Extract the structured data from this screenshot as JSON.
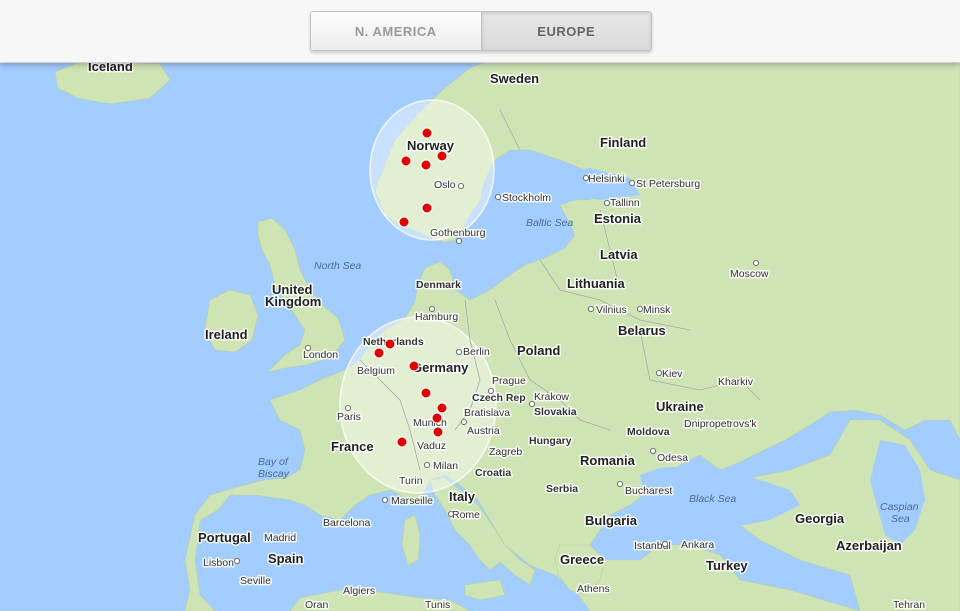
{
  "tabs": [
    {
      "label": "N. AMERICA",
      "active": false
    },
    {
      "label": "EUROPE",
      "active": true
    }
  ],
  "map": {
    "colors": {
      "water": "#a3ccff",
      "land": "#cfe4b4",
      "station": "#e00000",
      "coverage": "#ffffff"
    },
    "countries": [
      {
        "name": "Iceland"
      },
      {
        "name": "Sweden"
      },
      {
        "name": "Norway"
      },
      {
        "name": "Finland"
      },
      {
        "name": "Estonia"
      },
      {
        "name": "Latvia"
      },
      {
        "name": "Lithuania"
      },
      {
        "name": "Belarus"
      },
      {
        "name": "Denmark"
      },
      {
        "name": "United"
      },
      {
        "name": "Kingdom"
      },
      {
        "name": "Ireland"
      },
      {
        "name": "Netherlands"
      },
      {
        "name": "Belgium"
      },
      {
        "name": "Germany"
      },
      {
        "name": "Poland"
      },
      {
        "name": "Czech Rep"
      },
      {
        "name": "Slovakia"
      },
      {
        "name": "Ukraine"
      },
      {
        "name": "France"
      },
      {
        "name": "Austria"
      },
      {
        "name": "Hungary"
      },
      {
        "name": "Moldova"
      },
      {
        "name": "Romania"
      },
      {
        "name": "Croatia"
      },
      {
        "name": "Serbia"
      },
      {
        "name": "Italy"
      },
      {
        "name": "Bulgaria"
      },
      {
        "name": "Georgia"
      },
      {
        "name": "Azerbaijan"
      },
      {
        "name": "Portugal"
      },
      {
        "name": "Spain"
      },
      {
        "name": "Greece"
      },
      {
        "name": "Turkey"
      }
    ],
    "cities": [
      {
        "name": "Oslo"
      },
      {
        "name": "Stockholm"
      },
      {
        "name": "Helsinki"
      },
      {
        "name": "St Petersburg"
      },
      {
        "name": "Tallinn"
      },
      {
        "name": "Gothenburg"
      },
      {
        "name": "Moscow"
      },
      {
        "name": "Vilnius"
      },
      {
        "name": "Minsk"
      },
      {
        "name": "Hamburg"
      },
      {
        "name": "London"
      },
      {
        "name": "Berlin"
      },
      {
        "name": "Prague"
      },
      {
        "name": "Krakow"
      },
      {
        "name": "Kiev"
      },
      {
        "name": "Kharkiv"
      },
      {
        "name": "Paris"
      },
      {
        "name": "Bratislava"
      },
      {
        "name": "Munich"
      },
      {
        "name": "Dnipropetrovs'k"
      },
      {
        "name": "Vaduz"
      },
      {
        "name": "Zagreb"
      },
      {
        "name": "Odesa"
      },
      {
        "name": "Milan"
      },
      {
        "name": "Turin"
      },
      {
        "name": "Bucharest"
      },
      {
        "name": "Marseille"
      },
      {
        "name": "Barcelona"
      },
      {
        "name": "Rome"
      },
      {
        "name": "Madrid"
      },
      {
        "name": "Lisbon"
      },
      {
        "name": "Istanbul"
      },
      {
        "name": "Ankara"
      },
      {
        "name": "Seville"
      },
      {
        "name": "Algiers"
      },
      {
        "name": "Tunis"
      },
      {
        "name": "Athens"
      },
      {
        "name": "Oran"
      },
      {
        "name": "Tehran"
      }
    ],
    "seas": [
      {
        "name": "North Sea"
      },
      {
        "name": "Baltic Sea"
      },
      {
        "name": "Bay of"
      },
      {
        "name": "Biscay"
      },
      {
        "name": "Black Sea"
      },
      {
        "name": "Caspian"
      },
      {
        "name": "Sea"
      }
    ],
    "stations_count": 16
  }
}
